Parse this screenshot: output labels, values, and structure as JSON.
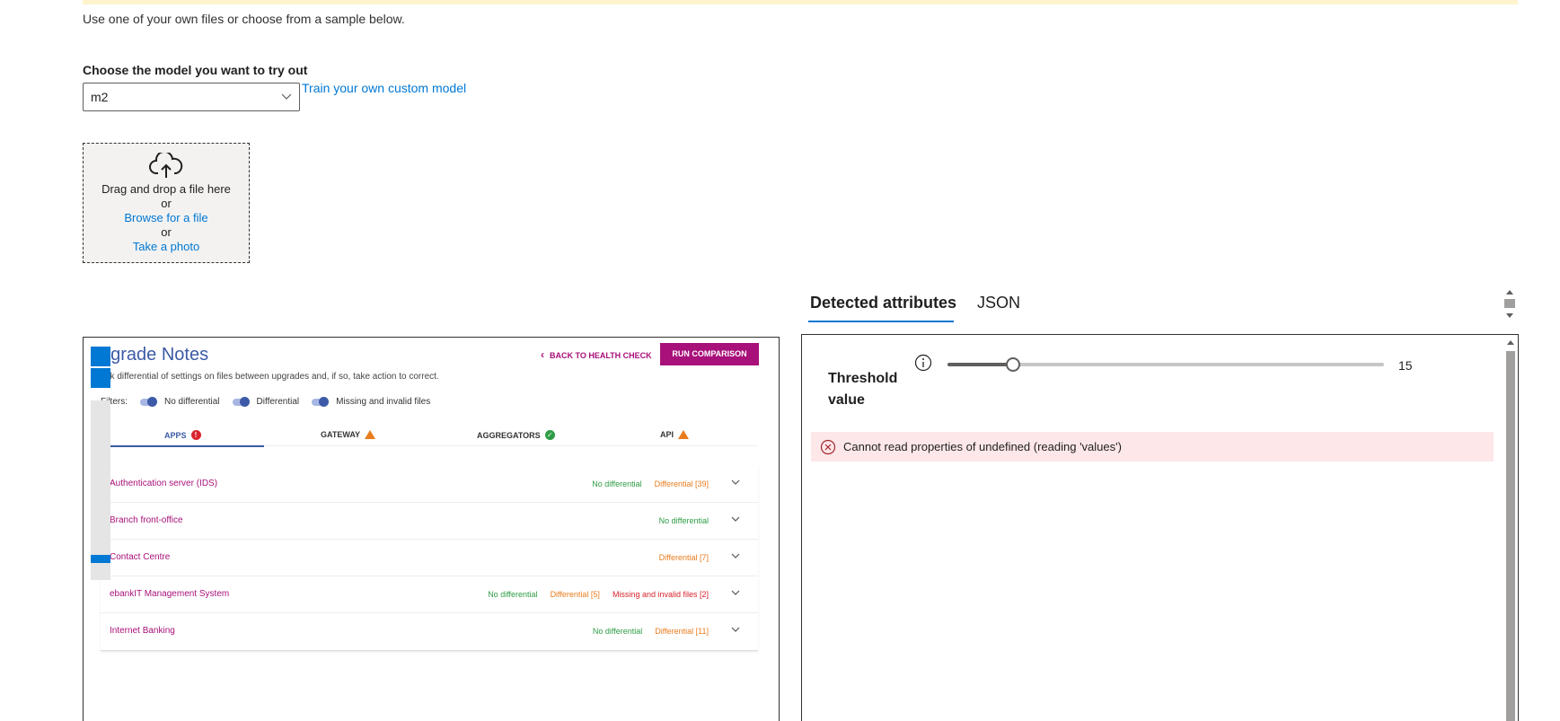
{
  "intro_text": "Use one of your own files or choose from a sample below.",
  "model": {
    "label": "Choose the model you want to try out",
    "selected": "m2",
    "train_link": "Train your own custom model"
  },
  "dropzone": {
    "icon": "cloud-upload-icon",
    "drag_text": "Drag and drop a file here",
    "or1": "or",
    "browse_link": "Browse for a file",
    "or2": "or",
    "photo_link": "Take a photo"
  },
  "preview": {
    "title": "pgrade Notes",
    "subtitle": "eck differential of settings on files between upgrades and, if so, take action to correct.",
    "back_link": "BACK TO HEALTH CHECK",
    "run_button": "RUN COMPARISON",
    "filters_label": "Filters:",
    "filters": [
      "No differential",
      "Differential",
      "Missing and invalid files"
    ],
    "tabs": [
      {
        "label": "APPS",
        "status": "error"
      },
      {
        "label": "GATEWAY",
        "status": "warning"
      },
      {
        "label": "AGGREGATORS",
        "status": "ok"
      },
      {
        "label": "API",
        "status": "warning"
      }
    ],
    "rows": [
      {
        "name": "Authentication server (IDS)",
        "tags": [
          {
            "text": "No differential",
            "kind": "green"
          },
          {
            "text": "Differential [39]",
            "kind": "orange"
          }
        ]
      },
      {
        "name": "Branch front-office",
        "tags": [
          {
            "text": "No differential",
            "kind": "green"
          }
        ]
      },
      {
        "name": "Contact Centre",
        "tags": [
          {
            "text": "Differential [7]",
            "kind": "orange"
          }
        ]
      },
      {
        "name": "ebankIT Management System",
        "tags": [
          {
            "text": "No differential",
            "kind": "green"
          },
          {
            "text": "Differential [5]",
            "kind": "orange"
          },
          {
            "text": "Missing and invalid files [2]",
            "kind": "red"
          }
        ]
      },
      {
        "name": "Internet Banking",
        "tags": [
          {
            "text": "No differential",
            "kind": "green"
          },
          {
            "text": "Differential [11]",
            "kind": "orange"
          }
        ]
      }
    ],
    "colors": {
      "title_blue": "#3c5aa6",
      "accent_magenta": "#a8107a"
    }
  },
  "result_tabs": {
    "detected": "Detected attributes",
    "json": "JSON",
    "active": "detected"
  },
  "threshold": {
    "label": "Threshold value",
    "value": "15",
    "fraction": 0.15,
    "info_icon": "info-icon"
  },
  "error": {
    "icon": "error-circle-icon",
    "message": "Cannot read properties of undefined (reading 'values')"
  },
  "colors": {
    "link_blue": "#0078d4",
    "banner_yellow": "#fff4ce",
    "error_bg": "#fde7e9"
  }
}
